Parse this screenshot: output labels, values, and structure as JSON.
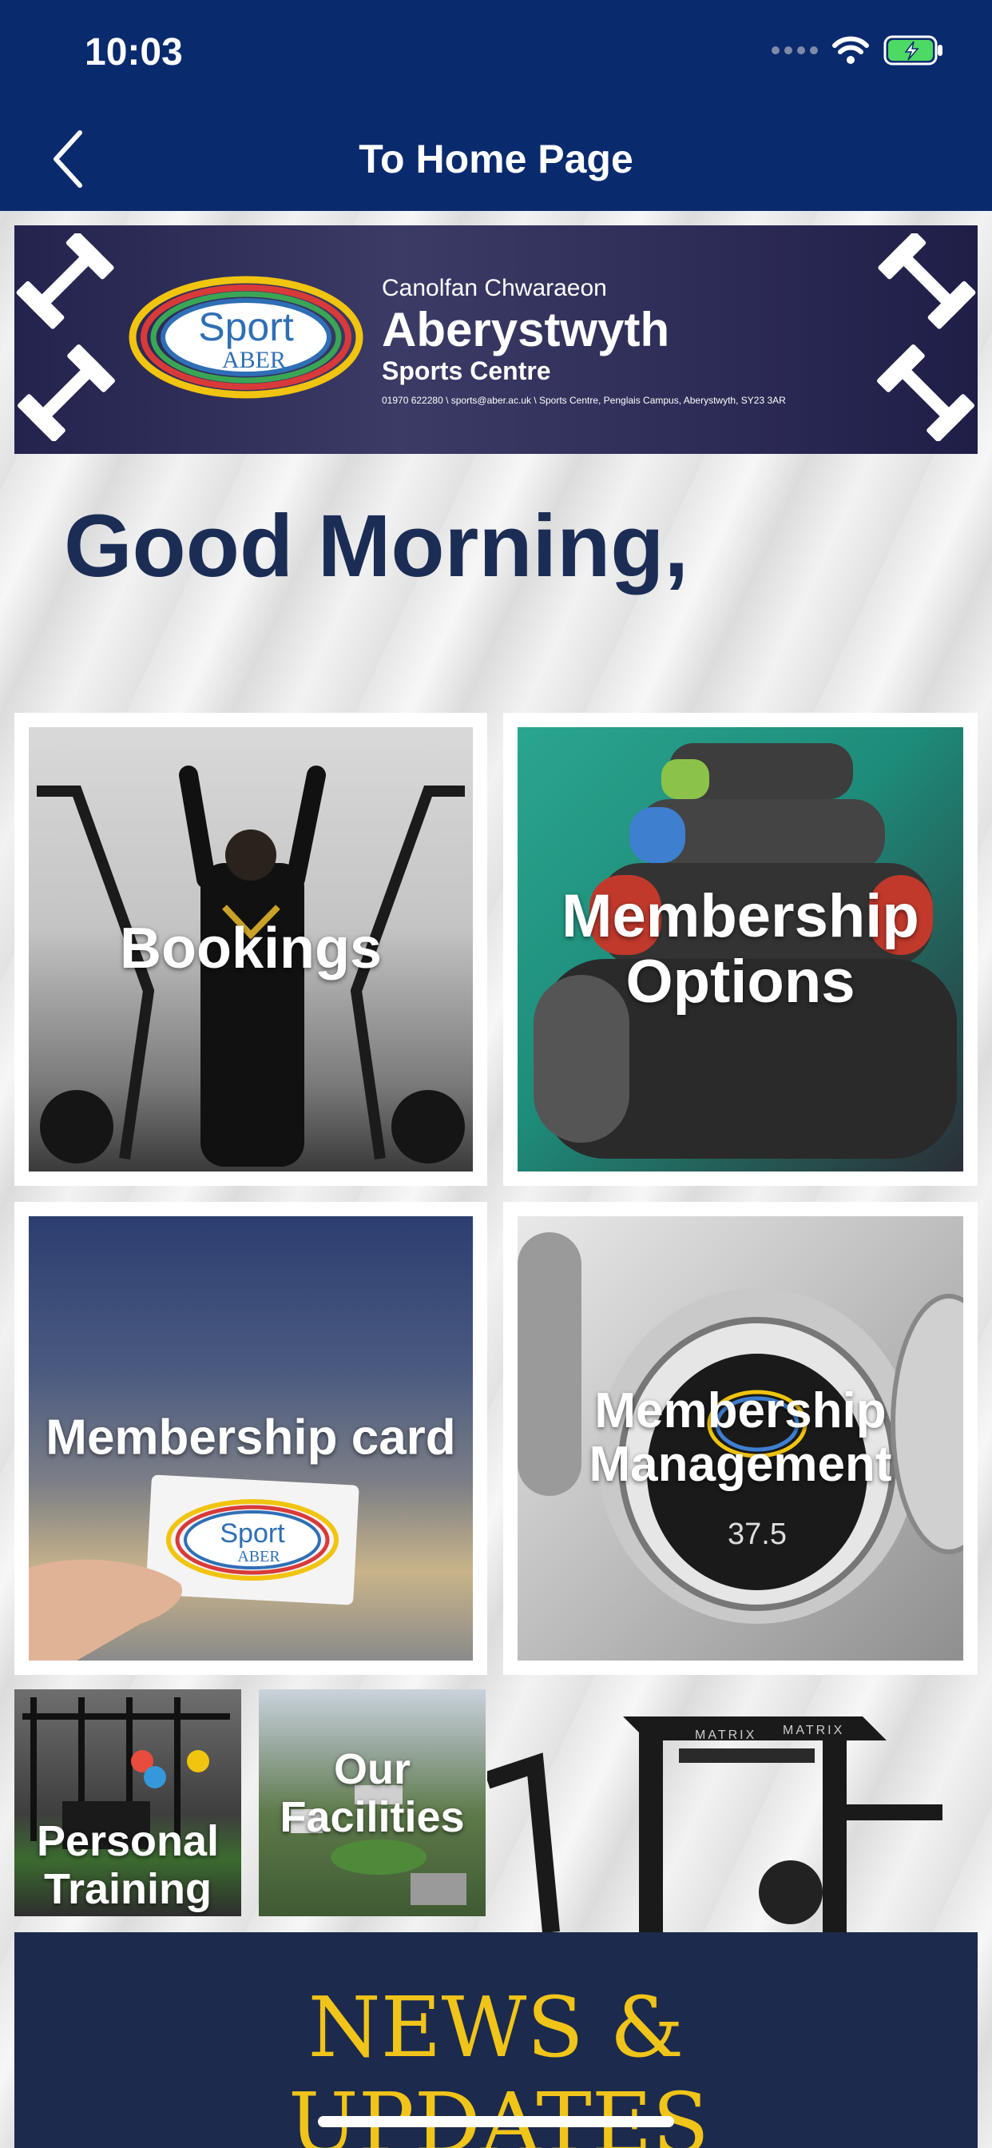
{
  "status_bar": {
    "time": "10:03"
  },
  "nav": {
    "title": "To Home Page"
  },
  "banner": {
    "logo_line1": "Sport",
    "logo_line2": "ABER",
    "welsh_name": "Canolfan Chwaraeon",
    "name": "Aberystwyth",
    "subtitle": "Sports Centre",
    "contact": "01970 622280 \\ sports@aber.ac.uk \\ Sports Centre, Penglais Campus, Aberystwyth, SY23 3AR"
  },
  "greeting": "Good Morning,",
  "tiles": [
    {
      "label": "Bookings"
    },
    {
      "label": "Membership Options"
    },
    {
      "label": "Membership card"
    },
    {
      "label": "Membership Management"
    }
  ],
  "card_logo": {
    "line1": "Sport",
    "line2": "ABER"
  },
  "dumbbell_weight": "37.5",
  "small_tiles": [
    {
      "label": "Personal Training"
    },
    {
      "label": "Our Facilities"
    }
  ],
  "equipment_brand": "MATRIX",
  "news": {
    "title": "NEWS & UPDATES"
  },
  "colors": {
    "nav": "#0a2a6e",
    "greeting": "#1b2d55",
    "news_bg": "#1c2a4d",
    "news_title": "#f0c419"
  }
}
